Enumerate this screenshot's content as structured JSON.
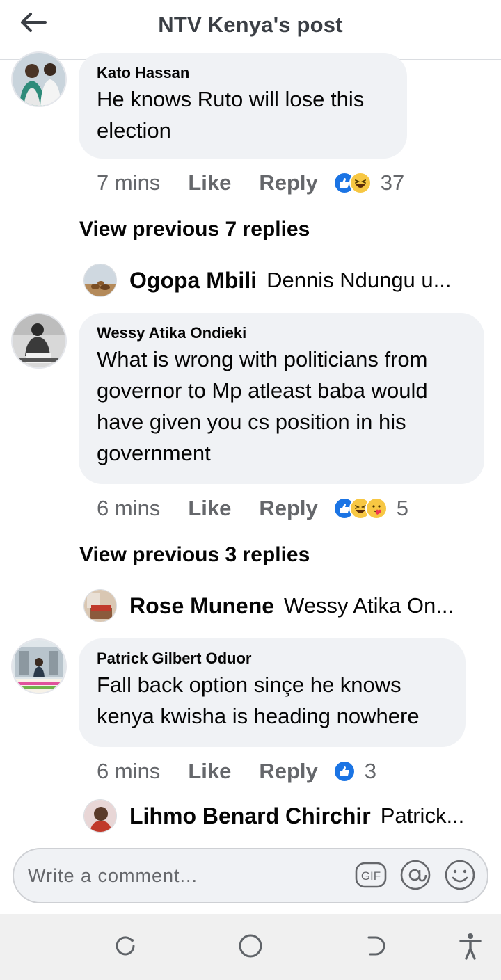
{
  "header": {
    "title": "NTV Kenya's post"
  },
  "comments": [
    {
      "author": "Kato Hassan",
      "lines": [
        "He knows Ruto will lose this",
        "election"
      ],
      "time": "7 mins",
      "like_label": "Like",
      "reply_label": "Reply",
      "reactions": [
        "like",
        "haha"
      ],
      "reaction_count": "37",
      "view_previous": "View previous 7 replies",
      "latest_reply": {
        "author": "Ogopa Mbili",
        "text": "Dennis Ndungu  u..."
      }
    },
    {
      "author": "Wessy Atika Ondieki",
      "lines": [
        "What is wrong with politicians from",
        "governor to Mp atleast baba would",
        "have given you cs position in his",
        "government"
      ],
      "time": "6 mins",
      "like_label": "Like",
      "reply_label": "Reply",
      "reactions": [
        "like",
        "haha",
        "care"
      ],
      "reaction_count": "5",
      "view_previous": "View previous 3 replies",
      "latest_reply": {
        "author": "Rose Munene",
        "text": "Wessy Atika On..."
      }
    },
    {
      "author": "Patrick Gilbert Oduor",
      "lines": [
        "Fall back option sinçe he knows",
        "kenya kwisha is heading nowhere"
      ],
      "time": "6 mins",
      "like_label": "Like",
      "reply_label": "Reply",
      "reactions": [
        "like"
      ],
      "reaction_count": "3",
      "latest_reply": {
        "author": "Lihmo Benard Chirchir",
        "text": "Patrick..."
      }
    }
  ],
  "composer": {
    "placeholder": "Write a comment..."
  },
  "icons": {
    "back": "arrow-left-icon",
    "gif": "gif-icon",
    "mention": "at-sign-icon",
    "emoji": "smiley-icon",
    "nav_recent": "recent-apps-icon",
    "nav_home": "home-circle-icon",
    "nav_back": "back-nav-icon",
    "nav_accessibility": "accessibility-icon"
  },
  "colors": {
    "like_blue": "#1b74e4",
    "haha_yellow": "#f7c743",
    "bubble_bg": "#f0f2f5",
    "meta_gray": "#65676b"
  }
}
